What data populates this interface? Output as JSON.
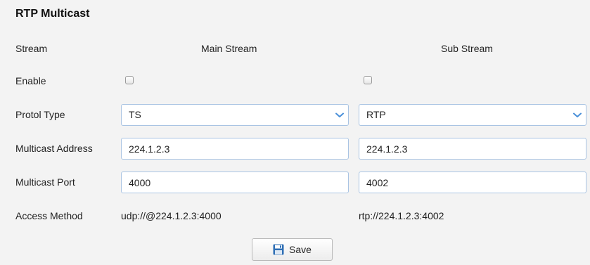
{
  "title": "RTP Multicast",
  "rows": {
    "stream_label": "Stream",
    "enable_label": "Enable",
    "protocol_label": "Protol Type",
    "address_label": "Multicast Address",
    "port_label": "Multicast Port",
    "access_label": "Access Method"
  },
  "main_stream": {
    "header": "Main Stream",
    "enabled": false,
    "protocol": "TS",
    "address": "224.1.2.3",
    "port": "4000",
    "access_method": "udp://@224.1.2.3:4000"
  },
  "sub_stream": {
    "header": "Sub Stream",
    "enabled": false,
    "protocol": "RTP",
    "address": "224.1.2.3",
    "port": "4002",
    "access_method": "rtp://224.1.2.3:4002"
  },
  "save_label": "Save",
  "colors": {
    "background": "#f3f3f3",
    "field_border": "#a9c4e3",
    "dropdown_arrow": "#4a90d9",
    "save_icon": "#2f6fb5"
  },
  "icons": {
    "dropdown": "chevron-down-icon",
    "save": "floppy-disk-icon"
  }
}
